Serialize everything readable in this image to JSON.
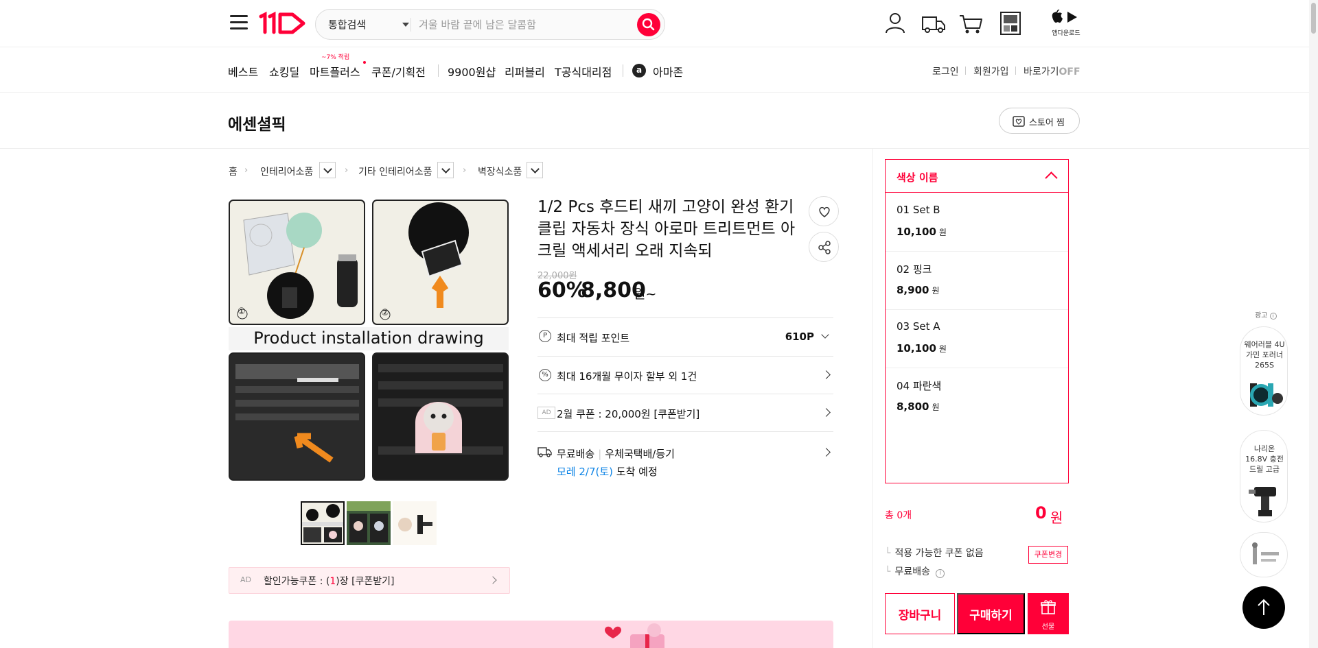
{
  "header": {
    "search_scope": "통합검색",
    "search_placeholder": "겨울 바람 끝에 남은 달콤함",
    "app_download_label": "앱다운로드"
  },
  "nav": {
    "items": [
      "베스트",
      "쇼킹딜",
      "마트플러스",
      "쿠폰/기획전",
      "9900원샵",
      "리퍼블리",
      "T공식대리점",
      "아마존"
    ],
    "badge": "~7% 적립",
    "utility": [
      "로그인",
      "회원가입",
      "바로가기"
    ],
    "shortcut_state": "OFF"
  },
  "store": {
    "name": "에센셜픽",
    "like_label": "스토어 찜"
  },
  "breadcrumb": [
    "홈",
    "인테리어소품",
    "기타 인테리어소품",
    "벽장식소품"
  ],
  "product": {
    "title": "1/2 Pcs 후드티 새끼 고양이 완성 환기 클립 자동차 장식 아로마 트리트먼트 아크릴 액세서리 오래 지속되",
    "image_caption": "Product installation drawing",
    "image_step_1": "①",
    "image_step_2": "②",
    "original_price": "22,000원",
    "discount_rate": "60%",
    "sale_price": "8,800",
    "price_unit": "원~",
    "points_label": "최대 적립 포인트",
    "points_value": "610P",
    "installment_label": "최대 16개월 무이자 할부 외 1건",
    "ad_tag": "AD",
    "coupon_label": "2월 쿠폰 : 20,000원 [쿠폰받기]",
    "shipping_label": "무료배송",
    "shipping_method": "우체국택배/등기",
    "delivery_date": "모레 2/7(토)",
    "delivery_suffix": "도착 예정",
    "coupon_banner_tag": "AD",
    "coupon_banner_text_1": "할인가능쿠폰 : (",
    "coupon_banner_count": "1",
    "coupon_banner_text_2": ")장 [쿠폰받기]"
  },
  "options": {
    "header": "색상 이름",
    "items": [
      {
        "name": "01 Set B",
        "price": "10,100",
        "unit": "원"
      },
      {
        "name": "02 핑크",
        "price": "8,900",
        "unit": "원"
      },
      {
        "name": "03 Set A",
        "price": "10,100",
        "unit": "원"
      },
      {
        "name": "04 파란색",
        "price": "8,800",
        "unit": "원"
      }
    ]
  },
  "order": {
    "total_label": "총 0개",
    "total_price": "0",
    "total_unit": "원",
    "coupon_none": "적용 가능한 쿠폰 없음",
    "coupon_change": "쿠폰변경",
    "free_shipping": "무료배송",
    "cart": "장바구니",
    "buy": "구매하기",
    "gift": "선물"
  },
  "ads": {
    "label": "광고",
    "items": [
      {
        "text": "웨어러블 4U 가민 포러너 265S"
      },
      {
        "text": "나리온 16.8V 충전 드릴 고급"
      }
    ]
  },
  "colors": {
    "brand": "#ff0038",
    "link_blue": "#0b83e6"
  }
}
